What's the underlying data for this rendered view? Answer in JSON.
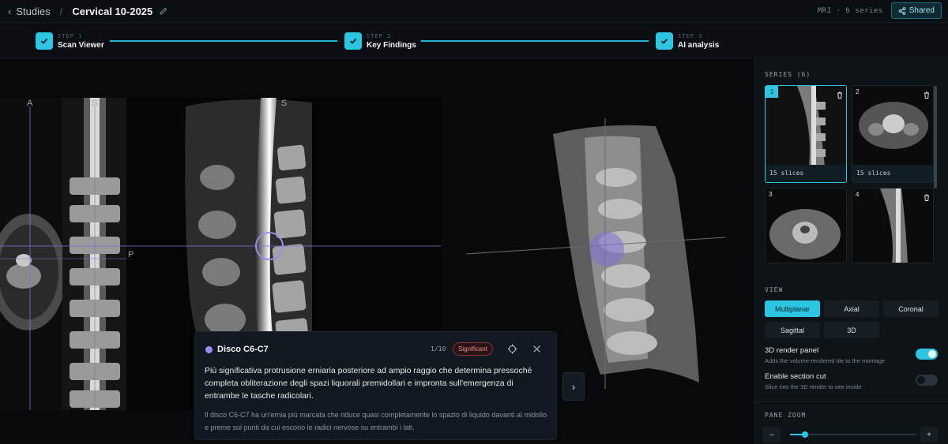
{
  "topbar": {
    "back_icon": "chevron-left-icon",
    "studies_label": "Studies",
    "separator": "/",
    "title": "Cervical 10-2025",
    "meta": "MRI · 6 series",
    "shared_label": "Shared"
  },
  "steps": [
    {
      "num": "STEP 1",
      "label": "Scan Viewer"
    },
    {
      "num": "STEP 2",
      "label": "Key Findings"
    },
    {
      "num": "STEP 3",
      "label": "AI analysis"
    }
  ],
  "viewer": {
    "labels": {
      "a": "A",
      "s1": "S",
      "s2": "S",
      "p": "P"
    },
    "next_icon": "›"
  },
  "finding": {
    "title": "Disco C6-C7",
    "counter": "1/10",
    "severity": "Significant",
    "body": "Più significativa protrusione erniaria posteriore ad ampio raggio che determina pressoché completa obliterazione degli spazi liquorali premidollari e impronta sull'emergenza di entrambe le tasche radicolari.",
    "note": "Il disco C6-C7 ha un'ernia più marcata che riduce quasi completamente lo spazio di liquido davanti al midollo e preme sui punti da cui escono le radici nervose su entrambi i lati."
  },
  "panel": {
    "series_title": "SERIES (6)",
    "series": [
      {
        "num": "1",
        "caption": "15 slices"
      },
      {
        "num": "2",
        "caption": "15 slices"
      },
      {
        "num": "3",
        "caption": ""
      },
      {
        "num": "4",
        "caption": ""
      }
    ],
    "view_title": "VIEW",
    "view_options": [
      "Multiplanar",
      "Axial",
      "Coronal",
      "Sagittal",
      "3D"
    ],
    "view_selected": "Multiplanar",
    "render_label": "3D render panel",
    "render_desc": "Adds the volume-rendered tile to the montage",
    "render_on": true,
    "section_label": "Enable section cut",
    "section_desc": "Slice into the 3D render to see inside",
    "section_on": false,
    "zoom_title": "PANE ZOOM",
    "zoom_minus": "–",
    "zoom_plus": "+",
    "zoom_level": 0.12
  },
  "colors": {
    "accent": "#2cc6e3",
    "finding": "#9b8cf0",
    "danger": "#f08a90"
  }
}
